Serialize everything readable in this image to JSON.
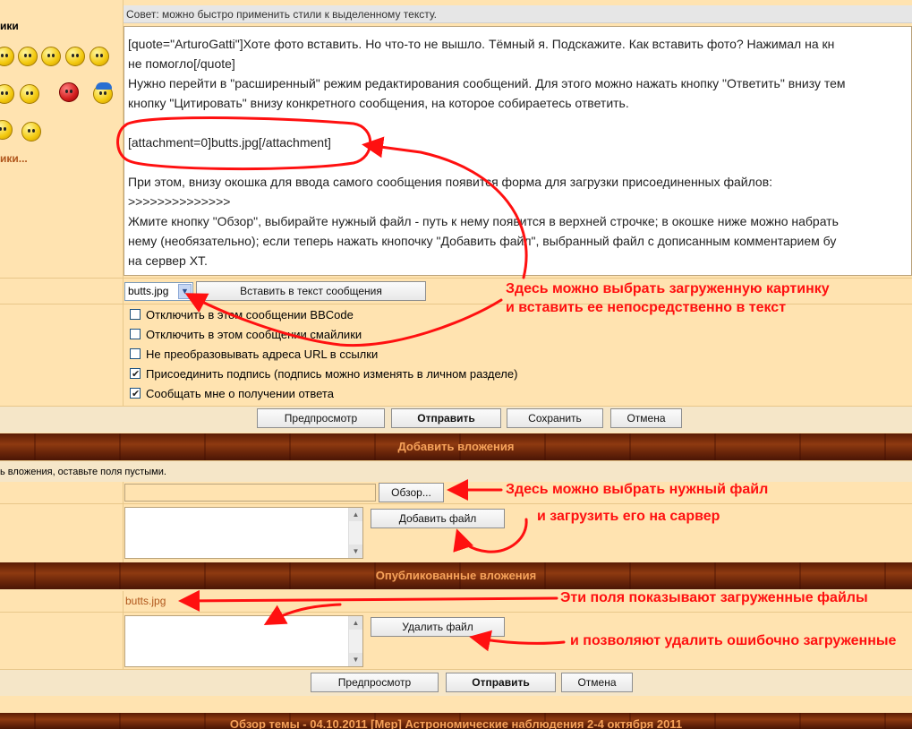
{
  "tip": "Совет: можно быстро применить стили к выделенному тексту.",
  "left": {
    "smilies_label": "ики",
    "more_smilies": "ики..."
  },
  "message": {
    "lines": [
      "[quote=\"ArturoGatti\"]Хоте фото вставить. Но что-то не вышло. Тёмный я. Подскажите. Как вставить фото? Нажимал на кн",
      "не помогло[/quote]",
      "Нужно перейти в \"расширенный\" режим редактирования сообщений. Для этого можно нажать кнопку \"Ответить\" внизу тем",
      "кнопку \"Цитировать\" внизу конкретного сообщения, на которое собираетесь ответить.",
      "",
      "[attachment=0]butts.jpg[/attachment]",
      "",
      "При этом, внизу окошка для ввода самого сообщения появится форма для загрузки присоединенных файлов:",
      ">>>>>>>>>>>>>>",
      "Жмите кнопку \"Обзор\", выбирайте нужный файл - путь к нему появится в верхней строчке; в окошке ниже можно набрать",
      "нему (необязательно); если теперь нажать кнопочку \"Добавить файл\", выбранный файл с дописанным комментарием бу",
      "на сервер ХТ."
    ]
  },
  "attach_select": {
    "value": "butts.jpg",
    "insert_button": "Вставить в текст сообщения"
  },
  "options": [
    {
      "label": "Отключить в этом сообщении BBCode",
      "checked": false
    },
    {
      "label": "Отключить в этом сообщении смайлики",
      "checked": false
    },
    {
      "label": "Не преобразовывать адреса URL в ссылки",
      "checked": false
    },
    {
      "label": "Присоединить подпись (подпись можно изменять в личном разделе)",
      "checked": true
    },
    {
      "label": "Сообщать мне о получении ответа",
      "checked": true
    }
  ],
  "actions": {
    "preview": "Предпросмотр",
    "submit": "Отправить",
    "save": "Сохранить",
    "cancel": "Отмена"
  },
  "add_attach": {
    "header": "Добавить вложения",
    "hint": "ь вложения, оставьте поля пустыми.",
    "browse": "Обзор...",
    "add_file": "Добавить файл"
  },
  "published": {
    "header": "Опубликованные вложения",
    "file": "butts.jpg",
    "delete_file": "Удалить файл"
  },
  "actions2": {
    "preview": "Предпросмотр",
    "submit": "Отправить",
    "cancel": "Отмена"
  },
  "footer_header": "Обзор темы - 04.10.2011 [Мер] Астрономические наблюдения 2-4 октября 2011",
  "annotations": {
    "a1": "Здесь можно выбрать загруженную картинку",
    "a2": "и вставить ее непосредственно в текст",
    "a3": "Здесь можно выбрать нужный файл",
    "a4": "и загрузить его на сарвер",
    "a5": "Эти поля показывают загруженные файлы",
    "a6": "и позволяют удалить ошибочно загруженные"
  },
  "colors": {
    "annotation": "#FF1010",
    "accent": "#B0561B",
    "wood": "#6B260A"
  }
}
